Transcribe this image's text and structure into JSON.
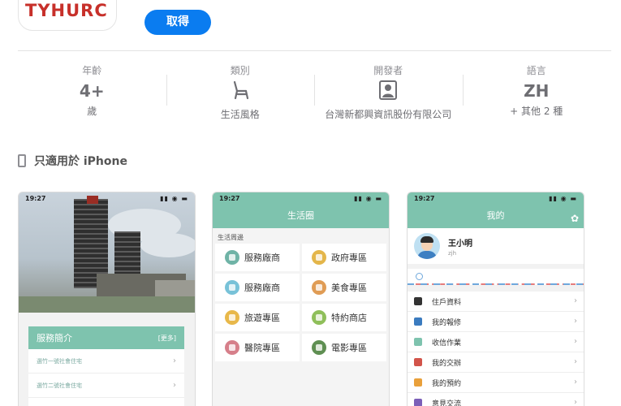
{
  "header": {
    "logo_text": "TYHURC",
    "get_label": "取得"
  },
  "info": [
    {
      "label": "年齡",
      "value": "4+",
      "sub": "歲",
      "icon": ""
    },
    {
      "label": "類別",
      "value": "",
      "sub": "生活風格",
      "icon": "chair-icon"
    },
    {
      "label": "開發者",
      "value": "",
      "sub": "台灣新都興資訊股份有限公司",
      "icon": "developer-portrait-icon"
    },
    {
      "label": "語言",
      "value": "ZH",
      "sub": "+ 其他 2 種",
      "icon": ""
    }
  ],
  "device_note": "只適用於 iPhone",
  "screenshots": {
    "shot1": {
      "time": "19:27",
      "panel_title": "服務簡介",
      "more": "[更多]",
      "items": [
        "選竹一號社會住宅",
        "選竹二號社會住宅"
      ]
    },
    "shot2": {
      "time": "19:27",
      "title": "生活圈",
      "section": "生活周邊",
      "cells": [
        {
          "label": "服務廠商",
          "color": "#6fb3a6"
        },
        {
          "label": "政府專區",
          "color": "#e4b64a"
        },
        {
          "label": "服務廠商",
          "color": "#78c2d8"
        },
        {
          "label": "美食專區",
          "color": "#e09c55"
        },
        {
          "label": "旅遊專區",
          "color": "#e8b84a"
        },
        {
          "label": "特約商店",
          "color": "#8fbf5a"
        },
        {
          "label": "醫院專區",
          "color": "#d67f8a"
        },
        {
          "label": "電影專區",
          "color": "#5f8f52"
        }
      ]
    },
    "shot3": {
      "time": "19:27",
      "title": "我的",
      "user_name": "王小明",
      "user_sub": "zjh",
      "menu": [
        {
          "label": "住戶資料",
          "color": "#333333"
        },
        {
          "label": "我的報修",
          "color": "#3b7bbf"
        },
        {
          "label": "收信作業",
          "color": "#7ec3ae"
        },
        {
          "label": "我的交辦",
          "color": "#d2544a"
        },
        {
          "label": "我的預約",
          "color": "#e9a03b"
        },
        {
          "label": "意見交流",
          "color": "#7b5fb8"
        }
      ]
    }
  }
}
